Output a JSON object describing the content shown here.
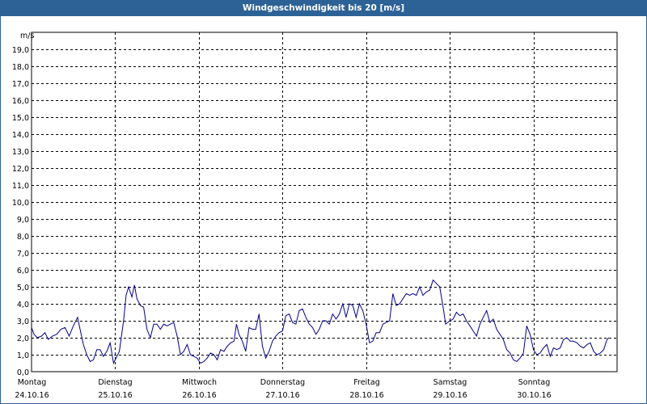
{
  "window": {
    "title": "Windgeschwindigkeit bis 20 [m/s]"
  },
  "chart_data": {
    "type": "line",
    "title": "Windgeschwindigkeit bis 20 [m/s]",
    "ylabel": "m/s",
    "ylim": [
      0,
      20
    ],
    "yticks": [
      "0,0",
      "1,0",
      "2,0",
      "3,0",
      "4,0",
      "5,0",
      "6,0",
      "7,0",
      "8,0",
      "9,0",
      "10,0",
      "11,0",
      "12,0",
      "13,0",
      "14,0",
      "15,0",
      "16,0",
      "17,0",
      "18,0",
      "19,0"
    ],
    "grid": true,
    "x_range_days": [
      0,
      7
    ],
    "days": [
      {
        "weekday": "Montag",
        "date": "24.10.16"
      },
      {
        "weekday": "Dienstag",
        "date": "25.10.16"
      },
      {
        "weekday": "Mittwoch",
        "date": "26.10.16"
      },
      {
        "weekday": "Donnerstag",
        "date": "27.10.16"
      },
      {
        "weekday": "Freitag",
        "date": "28.10.16"
      },
      {
        "weekday": "Samstag",
        "date": "29.10.16"
      },
      {
        "weekday": "Sonntag",
        "date": "30.10.16"
      }
    ],
    "series": [
      {
        "color": "#00008b",
        "points": [
          [
            0.0,
            2.6
          ],
          [
            0.03,
            2.2
          ],
          [
            0.07,
            2.0
          ],
          [
            0.12,
            2.1
          ],
          [
            0.16,
            2.3
          ],
          [
            0.2,
            1.9
          ],
          [
            0.25,
            2.1
          ],
          [
            0.3,
            2.2
          ],
          [
            0.35,
            2.5
          ],
          [
            0.4,
            2.6
          ],
          [
            0.45,
            2.1
          ],
          [
            0.5,
            2.7
          ],
          [
            0.55,
            3.2
          ],
          [
            0.58,
            2.5
          ],
          [
            0.62,
            1.6
          ],
          [
            0.66,
            1.0
          ],
          [
            0.7,
            0.6
          ],
          [
            0.74,
            0.7
          ],
          [
            0.78,
            1.3
          ],
          [
            0.82,
            1.3
          ],
          [
            0.86,
            0.9
          ],
          [
            0.9,
            1.2
          ],
          [
            0.94,
            1.7
          ],
          [
            0.98,
            0.5
          ],
          [
            1.0,
            0.7
          ],
          [
            1.05,
            1.2
          ],
          [
            1.1,
            3.0
          ],
          [
            1.13,
            4.5
          ],
          [
            1.16,
            5.0
          ],
          [
            1.2,
            4.4
          ],
          [
            1.23,
            5.1
          ],
          [
            1.26,
            4.3
          ],
          [
            1.3,
            3.9
          ],
          [
            1.34,
            3.8
          ],
          [
            1.38,
            2.5
          ],
          [
            1.42,
            2.0
          ],
          [
            1.46,
            2.8
          ],
          [
            1.5,
            2.8
          ],
          [
            1.54,
            2.5
          ],
          [
            1.58,
            2.8
          ],
          [
            1.62,
            2.7
          ],
          [
            1.66,
            2.8
          ],
          [
            1.7,
            2.9
          ],
          [
            1.74,
            2.1
          ],
          [
            1.78,
            1.0
          ],
          [
            1.82,
            1.2
          ],
          [
            1.86,
            1.6
          ],
          [
            1.9,
            1.0
          ],
          [
            1.94,
            0.9
          ],
          [
            1.98,
            0.8
          ],
          [
            2.02,
            0.5
          ],
          [
            2.06,
            0.6
          ],
          [
            2.1,
            0.8
          ],
          [
            2.14,
            1.1
          ],
          [
            2.18,
            1.0
          ],
          [
            2.22,
            0.7
          ],
          [
            2.26,
            1.3
          ],
          [
            2.3,
            1.2
          ],
          [
            2.34,
            1.5
          ],
          [
            2.38,
            1.7
          ],
          [
            2.42,
            1.8
          ],
          [
            2.45,
            2.8
          ],
          [
            2.48,
            2.2
          ],
          [
            2.52,
            1.8
          ],
          [
            2.56,
            1.2
          ],
          [
            2.6,
            2.6
          ],
          [
            2.64,
            2.5
          ],
          [
            2.68,
            2.5
          ],
          [
            2.72,
            3.4
          ],
          [
            2.76,
            1.5
          ],
          [
            2.8,
            0.8
          ],
          [
            2.84,
            1.2
          ],
          [
            2.88,
            1.8
          ],
          [
            2.92,
            2.1
          ],
          [
            2.96,
            2.3
          ],
          [
            3.0,
            2.4
          ],
          [
            3.04,
            3.3
          ],
          [
            3.08,
            3.4
          ],
          [
            3.12,
            2.9
          ],
          [
            3.16,
            2.8
          ],
          [
            3.2,
            3.6
          ],
          [
            3.24,
            3.7
          ],
          [
            3.28,
            3.2
          ],
          [
            3.32,
            2.8
          ],
          [
            3.36,
            2.6
          ],
          [
            3.4,
            2.2
          ],
          [
            3.44,
            2.5
          ],
          [
            3.48,
            3.0
          ],
          [
            3.52,
            3.0
          ],
          [
            3.56,
            2.8
          ],
          [
            3.6,
            3.4
          ],
          [
            3.64,
            3.1
          ],
          [
            3.68,
            3.4
          ],
          [
            3.72,
            4.0
          ],
          [
            3.76,
            3.2
          ],
          [
            3.8,
            4.0
          ],
          [
            3.84,
            3.9
          ],
          [
            3.88,
            3.2
          ],
          [
            3.92,
            4.0
          ],
          [
            3.96,
            3.6
          ],
          [
            4.0,
            2.8
          ],
          [
            4.04,
            1.7
          ],
          [
            4.08,
            1.8
          ],
          [
            4.12,
            2.3
          ],
          [
            4.16,
            2.3
          ],
          [
            4.2,
            2.8
          ],
          [
            4.24,
            2.9
          ],
          [
            4.28,
            3.0
          ],
          [
            4.32,
            4.6
          ],
          [
            4.36,
            3.9
          ],
          [
            4.4,
            4.0
          ],
          [
            4.44,
            4.3
          ],
          [
            4.48,
            4.6
          ],
          [
            4.52,
            4.5
          ],
          [
            4.56,
            4.6
          ],
          [
            4.6,
            4.5
          ],
          [
            4.64,
            5.0
          ],
          [
            4.68,
            4.5
          ],
          [
            4.72,
            4.7
          ],
          [
            4.76,
            4.8
          ],
          [
            4.8,
            5.4
          ],
          [
            4.84,
            5.2
          ],
          [
            4.88,
            5.0
          ],
          [
            4.92,
            3.8
          ],
          [
            4.95,
            2.8
          ],
          [
            5.0,
            3.0
          ],
          [
            5.04,
            3.1
          ],
          [
            5.08,
            3.5
          ],
          [
            5.12,
            3.3
          ],
          [
            5.16,
            3.4
          ],
          [
            5.2,
            3.0
          ],
          [
            5.24,
            2.7
          ],
          [
            5.28,
            2.4
          ],
          [
            5.32,
            2.1
          ],
          [
            5.36,
            2.8
          ],
          [
            5.4,
            3.2
          ],
          [
            5.44,
            3.6
          ],
          [
            5.48,
            2.9
          ],
          [
            5.52,
            3.1
          ],
          [
            5.56,
            2.5
          ],
          [
            5.6,
            2.2
          ],
          [
            5.64,
            1.9
          ],
          [
            5.68,
            1.3
          ],
          [
            5.72,
            1.1
          ],
          [
            5.76,
            0.7
          ],
          [
            5.8,
            0.6
          ],
          [
            5.84,
            0.8
          ],
          [
            5.88,
            1.1
          ],
          [
            5.92,
            2.7
          ],
          [
            5.96,
            2.2
          ],
          [
            6.0,
            1.3
          ],
          [
            6.04,
            1.0
          ],
          [
            6.08,
            1.1
          ],
          [
            6.12,
            1.4
          ],
          [
            6.16,
            1.6
          ],
          [
            6.2,
            0.9
          ],
          [
            6.24,
            1.4
          ],
          [
            6.28,
            1.3
          ],
          [
            6.32,
            1.4
          ],
          [
            6.36,
            1.9
          ],
          [
            6.4,
            2.0
          ],
          [
            6.44,
            1.8
          ],
          [
            6.48,
            1.8
          ],
          [
            6.52,
            1.7
          ],
          [
            6.56,
            1.5
          ],
          [
            6.6,
            1.4
          ],
          [
            6.64,
            1.6
          ],
          [
            6.68,
            1.7
          ],
          [
            6.72,
            1.2
          ],
          [
            6.76,
            1.0
          ],
          [
            6.8,
            1.1
          ],
          [
            6.84,
            1.3
          ],
          [
            6.88,
            1.9
          ],
          [
            6.9,
            2.0
          ]
        ]
      }
    ]
  }
}
